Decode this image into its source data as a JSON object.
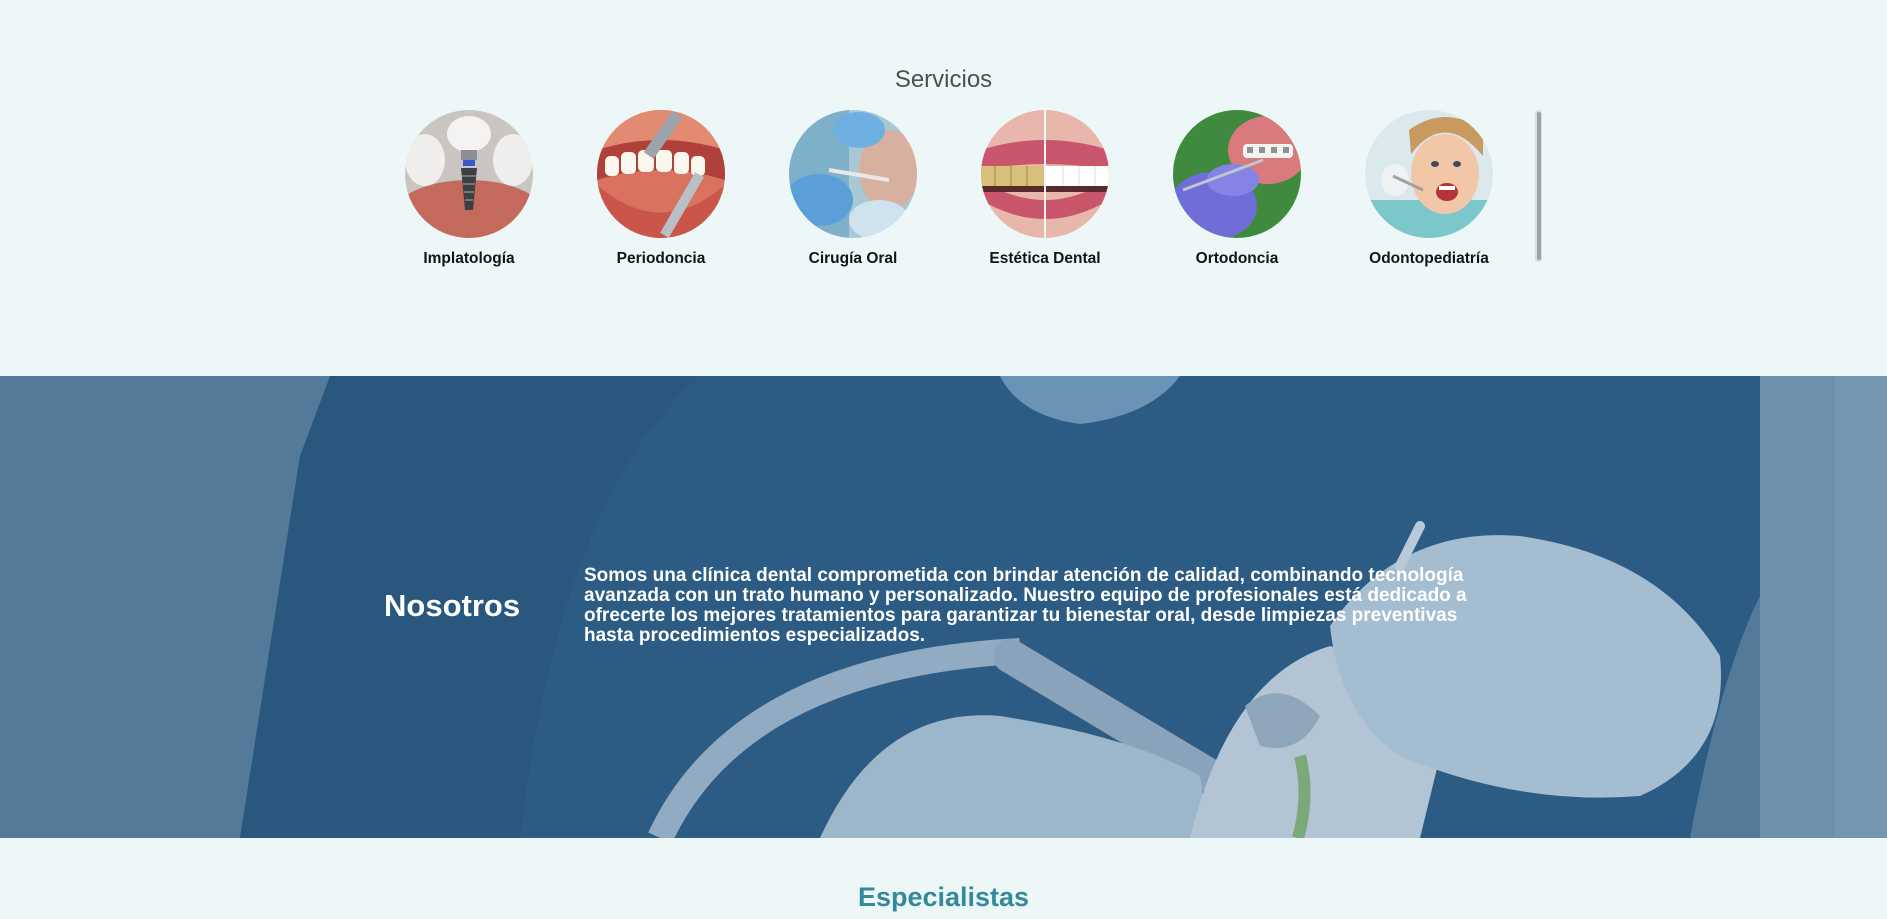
{
  "services": {
    "title": "Servicios",
    "items": [
      {
        "label": "Implatología",
        "icon": "dental-implant-photo"
      },
      {
        "label": "Periodoncia",
        "icon": "gum-cleaning-photo"
      },
      {
        "label": "Cirugía Oral",
        "icon": "oral-surgery-photo"
      },
      {
        "label": "Estética Dental",
        "icon": "teeth-whitening-photo"
      },
      {
        "label": "Ortodoncia",
        "icon": "braces-photo"
      },
      {
        "label": "Odontopediatría",
        "icon": "child-dentist-photo"
      }
    ]
  },
  "about": {
    "title": "Nosotros",
    "text": "Somos una clínica dental comprometida con brindar atención de calidad, combinando tecnología avanzada con un trato humano y personalizado. Nuestro equipo de profesionales está dedicado a ofrecerte los mejores tratamientos para garantizar tu bienestar oral, desde limpiezas preventivas hasta procedimientos especializados."
  },
  "specialists": {
    "title": "Especialistas"
  },
  "colors": {
    "page_background": "#eef7f8",
    "about_overlay": "#2f5f86",
    "specialists_title": "#338a9a"
  }
}
